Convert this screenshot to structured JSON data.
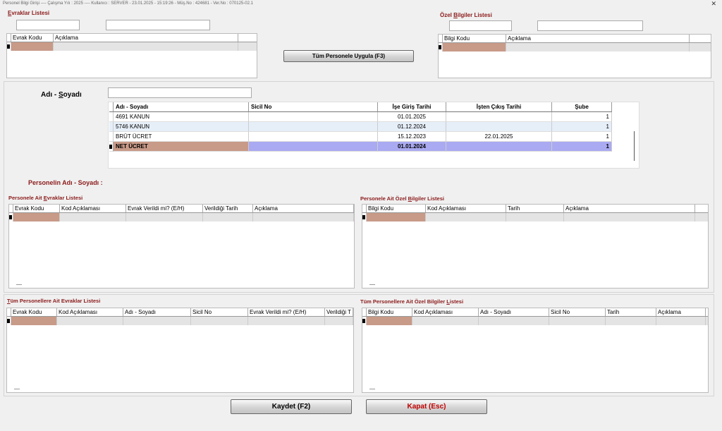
{
  "window": {
    "title": "Personel Bilgi Girişi  ----  Çalışma Yılı : 2025  ----  Kullanıcı : SERVER - 23.01.2025 - 15:19:26 - Müş.No : 424681 - Ver.No : 070125-02.1",
    "close_glyph": "✕"
  },
  "evraklar": {
    "title_prefix": "E",
    "title_rest": "vraklar Listesi",
    "headers": [
      "Evrak Kodu",
      "Açıklama"
    ]
  },
  "ozel": {
    "title_prefix": "Özel ",
    "title_u": "B",
    "title_rest": "ilgiler Listesi",
    "headers": [
      "Bilgi Kodu",
      "Açıklama"
    ]
  },
  "apply_button": "Tüm Personele Uygula (F3)",
  "adsoyad": {
    "label_prefix": "Adı - ",
    "label_u": "S",
    "label_rest": "oyadı",
    "headers": [
      "Adı - Soyadı",
      "Sicil No",
      "İşe Giriş Tarihi",
      "İşten Çıkış Tarihi",
      "Şube"
    ],
    "rows": [
      {
        "ad": "4691 KANUN",
        "sicil": "",
        "ise": "01.01.2025",
        "cikis": "",
        "sube": "1"
      },
      {
        "ad": "5746 KANUN",
        "sicil": "",
        "ise": "01.12.2024",
        "cikis": "",
        "sube": "1"
      },
      {
        "ad": "BRÜT ÜCRET",
        "sicil": "",
        "ise": "15.12.2023",
        "cikis": "22.01.2025",
        "sube": "1"
      },
      {
        "ad": "NET ÜCRET",
        "sicil": "",
        "ise": "01.01.2024",
        "cikis": "",
        "sube": "1"
      }
    ]
  },
  "personel_name_label": "Personelin Adı - Soyadı :",
  "pe": {
    "title_prefix": "Personele Ait ",
    "title_u": "E",
    "title_rest": "vraklar Listesi",
    "headers": [
      "Evrak Kodu",
      "Kod Açıklaması",
      "Evrak Verildi mi? (E/H)",
      "Verildiği Tarih",
      "Açıklama"
    ]
  },
  "pb": {
    "title_prefix": "Personele Ait Özel ",
    "title_u": "B",
    "title_rest": "ilgiler Listesi",
    "headers": [
      "Bilgi Kodu",
      "Kod Açıklaması",
      "Tarih",
      "Açıklama"
    ]
  },
  "te": {
    "title_prefix": "T",
    "title_rest": "üm Personellere Ait Evraklar Listesi",
    "headers": [
      "Evrak Kodu",
      "Kod Açıklaması",
      "Adı - Soyadı",
      "Sicil No",
      "Evrak Verildi mi? (E/H)",
      "Verildiği T"
    ]
  },
  "tb": {
    "title_prefix": "Tüm Personellere Ait Özel Bilgiler ",
    "title_u": "L",
    "title_rest": "istesi",
    "headers": [
      "Bilgi Kodu",
      "Kod Açıklaması",
      "Adı - Soyadı",
      "Sicil No",
      "Tarih",
      "Açıklama"
    ]
  },
  "buttons": {
    "save": "Kaydet (F2)",
    "close": "Kapat (Esc)"
  },
  "colors": {
    "section_title": "#8b1a1a",
    "selected_cell": "#c89a88",
    "selected_row": "#aaaaf2",
    "close_text": "#c00000"
  }
}
